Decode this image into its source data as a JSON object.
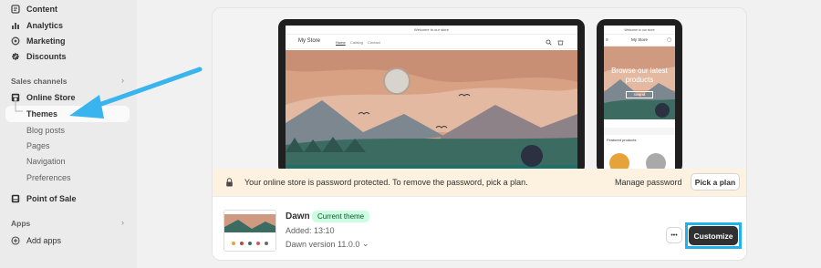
{
  "sidebar": {
    "items_top": [
      {
        "label": "Content",
        "icon": "content-icon"
      },
      {
        "label": "Analytics",
        "icon": "analytics-icon"
      },
      {
        "label": "Marketing",
        "icon": "marketing-icon"
      },
      {
        "label": "Discounts",
        "icon": "discounts-icon"
      }
    ],
    "sales_channels_label": "Sales channels",
    "online_store_label": "Online Store",
    "online_store_subitems": [
      "Themes",
      "Blog posts",
      "Pages",
      "Navigation",
      "Preferences"
    ],
    "point_of_sale_label": "Point of Sale",
    "apps_label": "Apps",
    "add_apps_label": "Add apps"
  },
  "preview": {
    "desktop": {
      "announcement": "Welcome to our store",
      "store_name": "My Store",
      "nav": [
        "Home",
        "Catalog",
        "Contact"
      ]
    },
    "mobile": {
      "announcement": "Welcome to our store",
      "store_name": "My Store",
      "hero_title": "Browse our latest products",
      "hero_button": "Shop all",
      "featured_label": "Featured products"
    }
  },
  "banner": {
    "message": "Your online store is password protected. To remove the password, pick a plan.",
    "manage_password": "Manage password",
    "pick_plan": "Pick a plan"
  },
  "theme": {
    "name": "Dawn",
    "badge": "Current theme",
    "added": "Added: 13:10",
    "version": "Dawn version 11.0.0",
    "more": "•••",
    "customize": "Customize"
  },
  "colors": {
    "accent_arrow": "#3ab4ee",
    "highlight_box": "#23b1ec",
    "badge_bg": "#cdfee1",
    "badge_text": "#0c5132",
    "customize_bg": "#303030",
    "banner_bg": "#fdf1e0"
  }
}
